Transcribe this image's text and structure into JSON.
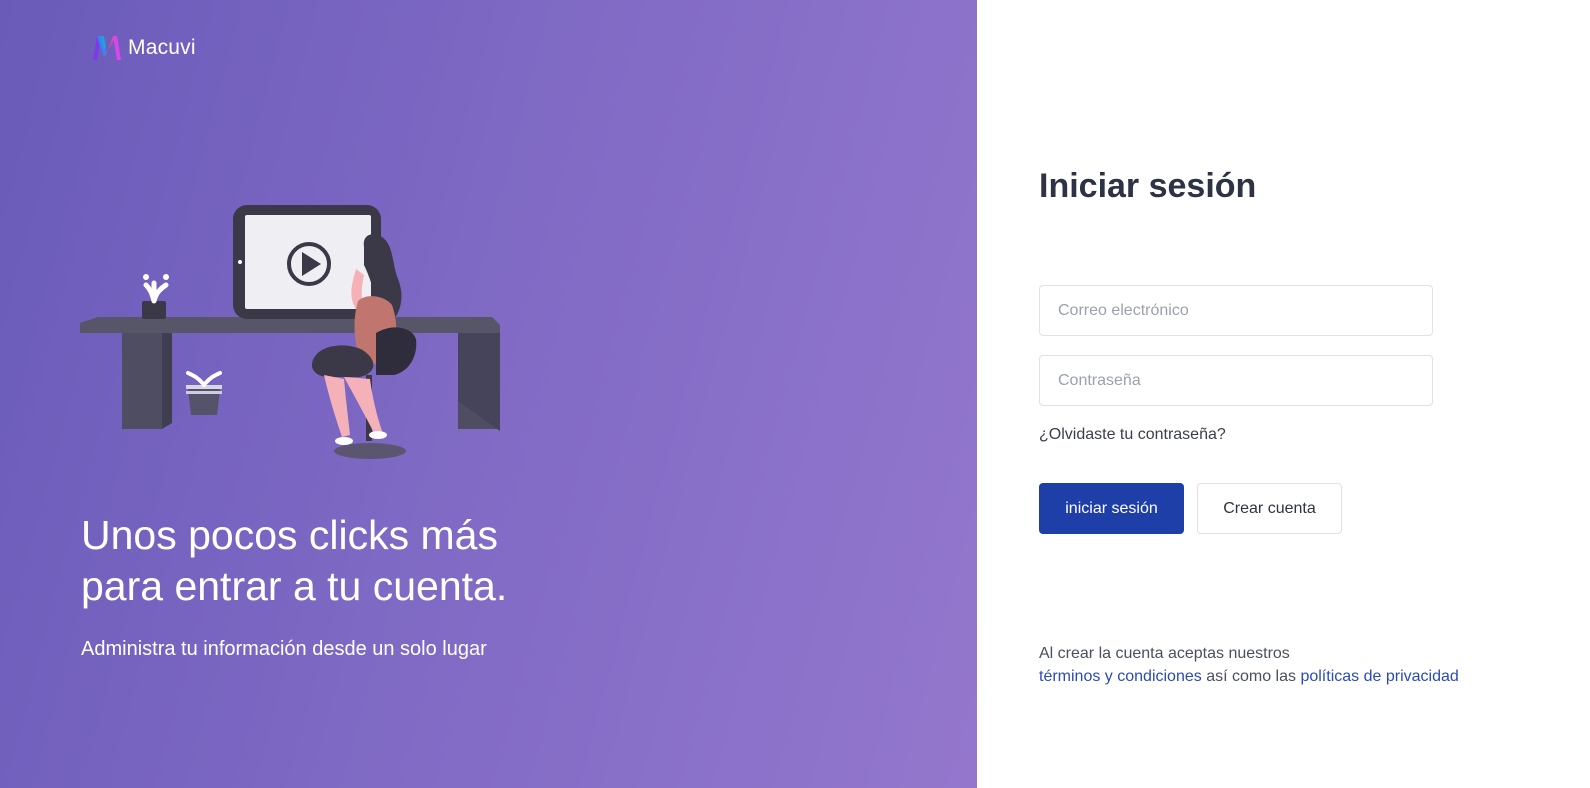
{
  "brand": {
    "name": "Macuvi",
    "colors": {
      "left_gradient_start": "#6a5bb9",
      "left_gradient_end": "#9477cd",
      "primary_button": "#1e3ea8",
      "link": "#2a4bb5",
      "title": "#2b3345"
    }
  },
  "left": {
    "headline": "Unos pocos clicks más para entrar a tu cuenta.",
    "subline": "Administra tu información desde un solo lugar"
  },
  "login": {
    "title": "Iniciar sesión",
    "email_placeholder": "Correo electrónico",
    "password_placeholder": "Contraseña",
    "forgot_label": "¿Olvidaste tu contraseña?",
    "login_button": "iniciar sesión",
    "create_button": "Crear cuenta"
  },
  "terms": {
    "line1": "Al crear la cuenta aceptas nuestros",
    "terms_link": "términos y condiciones",
    "middle": " así como las ",
    "privacy_link": "políticas de privacidad"
  }
}
